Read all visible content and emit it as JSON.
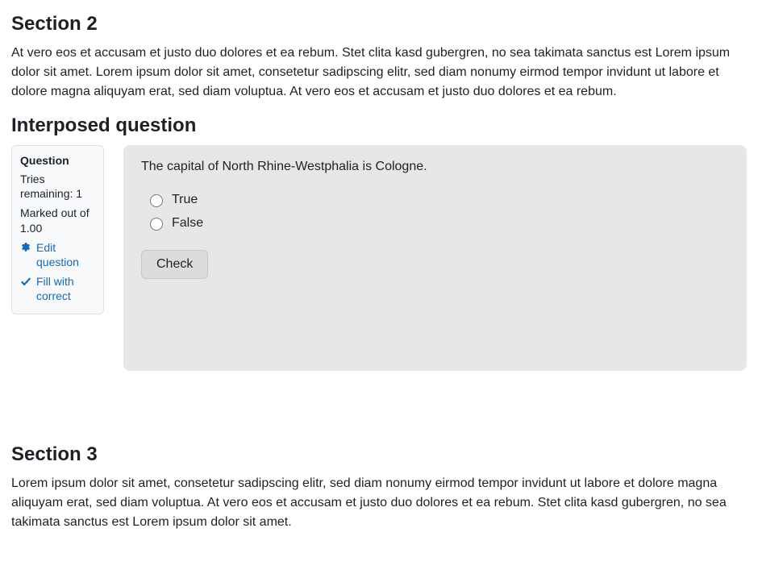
{
  "section2": {
    "heading": "Section 2",
    "body": "At vero eos et accusam et justo duo dolores et ea rebum. Stet clita kasd gubergren, no sea takimata sanctus est Lorem ipsum dolor sit amet. Lorem ipsum dolor sit amet, consetetur sadipscing elitr, sed diam nonumy eirmod tempor invidunt ut labore et dolore magna aliquyam erat, sed diam voluptua. At vero eos et accusam et justo duo dolores et ea rebum."
  },
  "interposed": {
    "heading": "Interposed question",
    "info": {
      "label": "Question",
      "tries_label": "Tries remaining:",
      "tries_value": "1",
      "marked_label": "Marked out of",
      "marked_value": "1.00",
      "edit_link": "Edit question",
      "fill_link": "Fill with correct"
    },
    "question_text": "The capital of North Rhine-Westphalia is Cologne.",
    "options": {
      "true_label": "True",
      "false_label": "False"
    },
    "check_label": "Check"
  },
  "section3": {
    "heading": "Section 3",
    "body": "Lorem ipsum dolor sit amet, consetetur sadipscing elitr, sed diam nonumy eirmod tempor invidunt ut labore et dolore magna aliquyam erat, sed diam voluptua. At vero eos et accusam et justo duo dolores et ea rebum. Stet clita kasd gubergren, no sea takimata sanctus est Lorem ipsum dolor sit amet."
  }
}
